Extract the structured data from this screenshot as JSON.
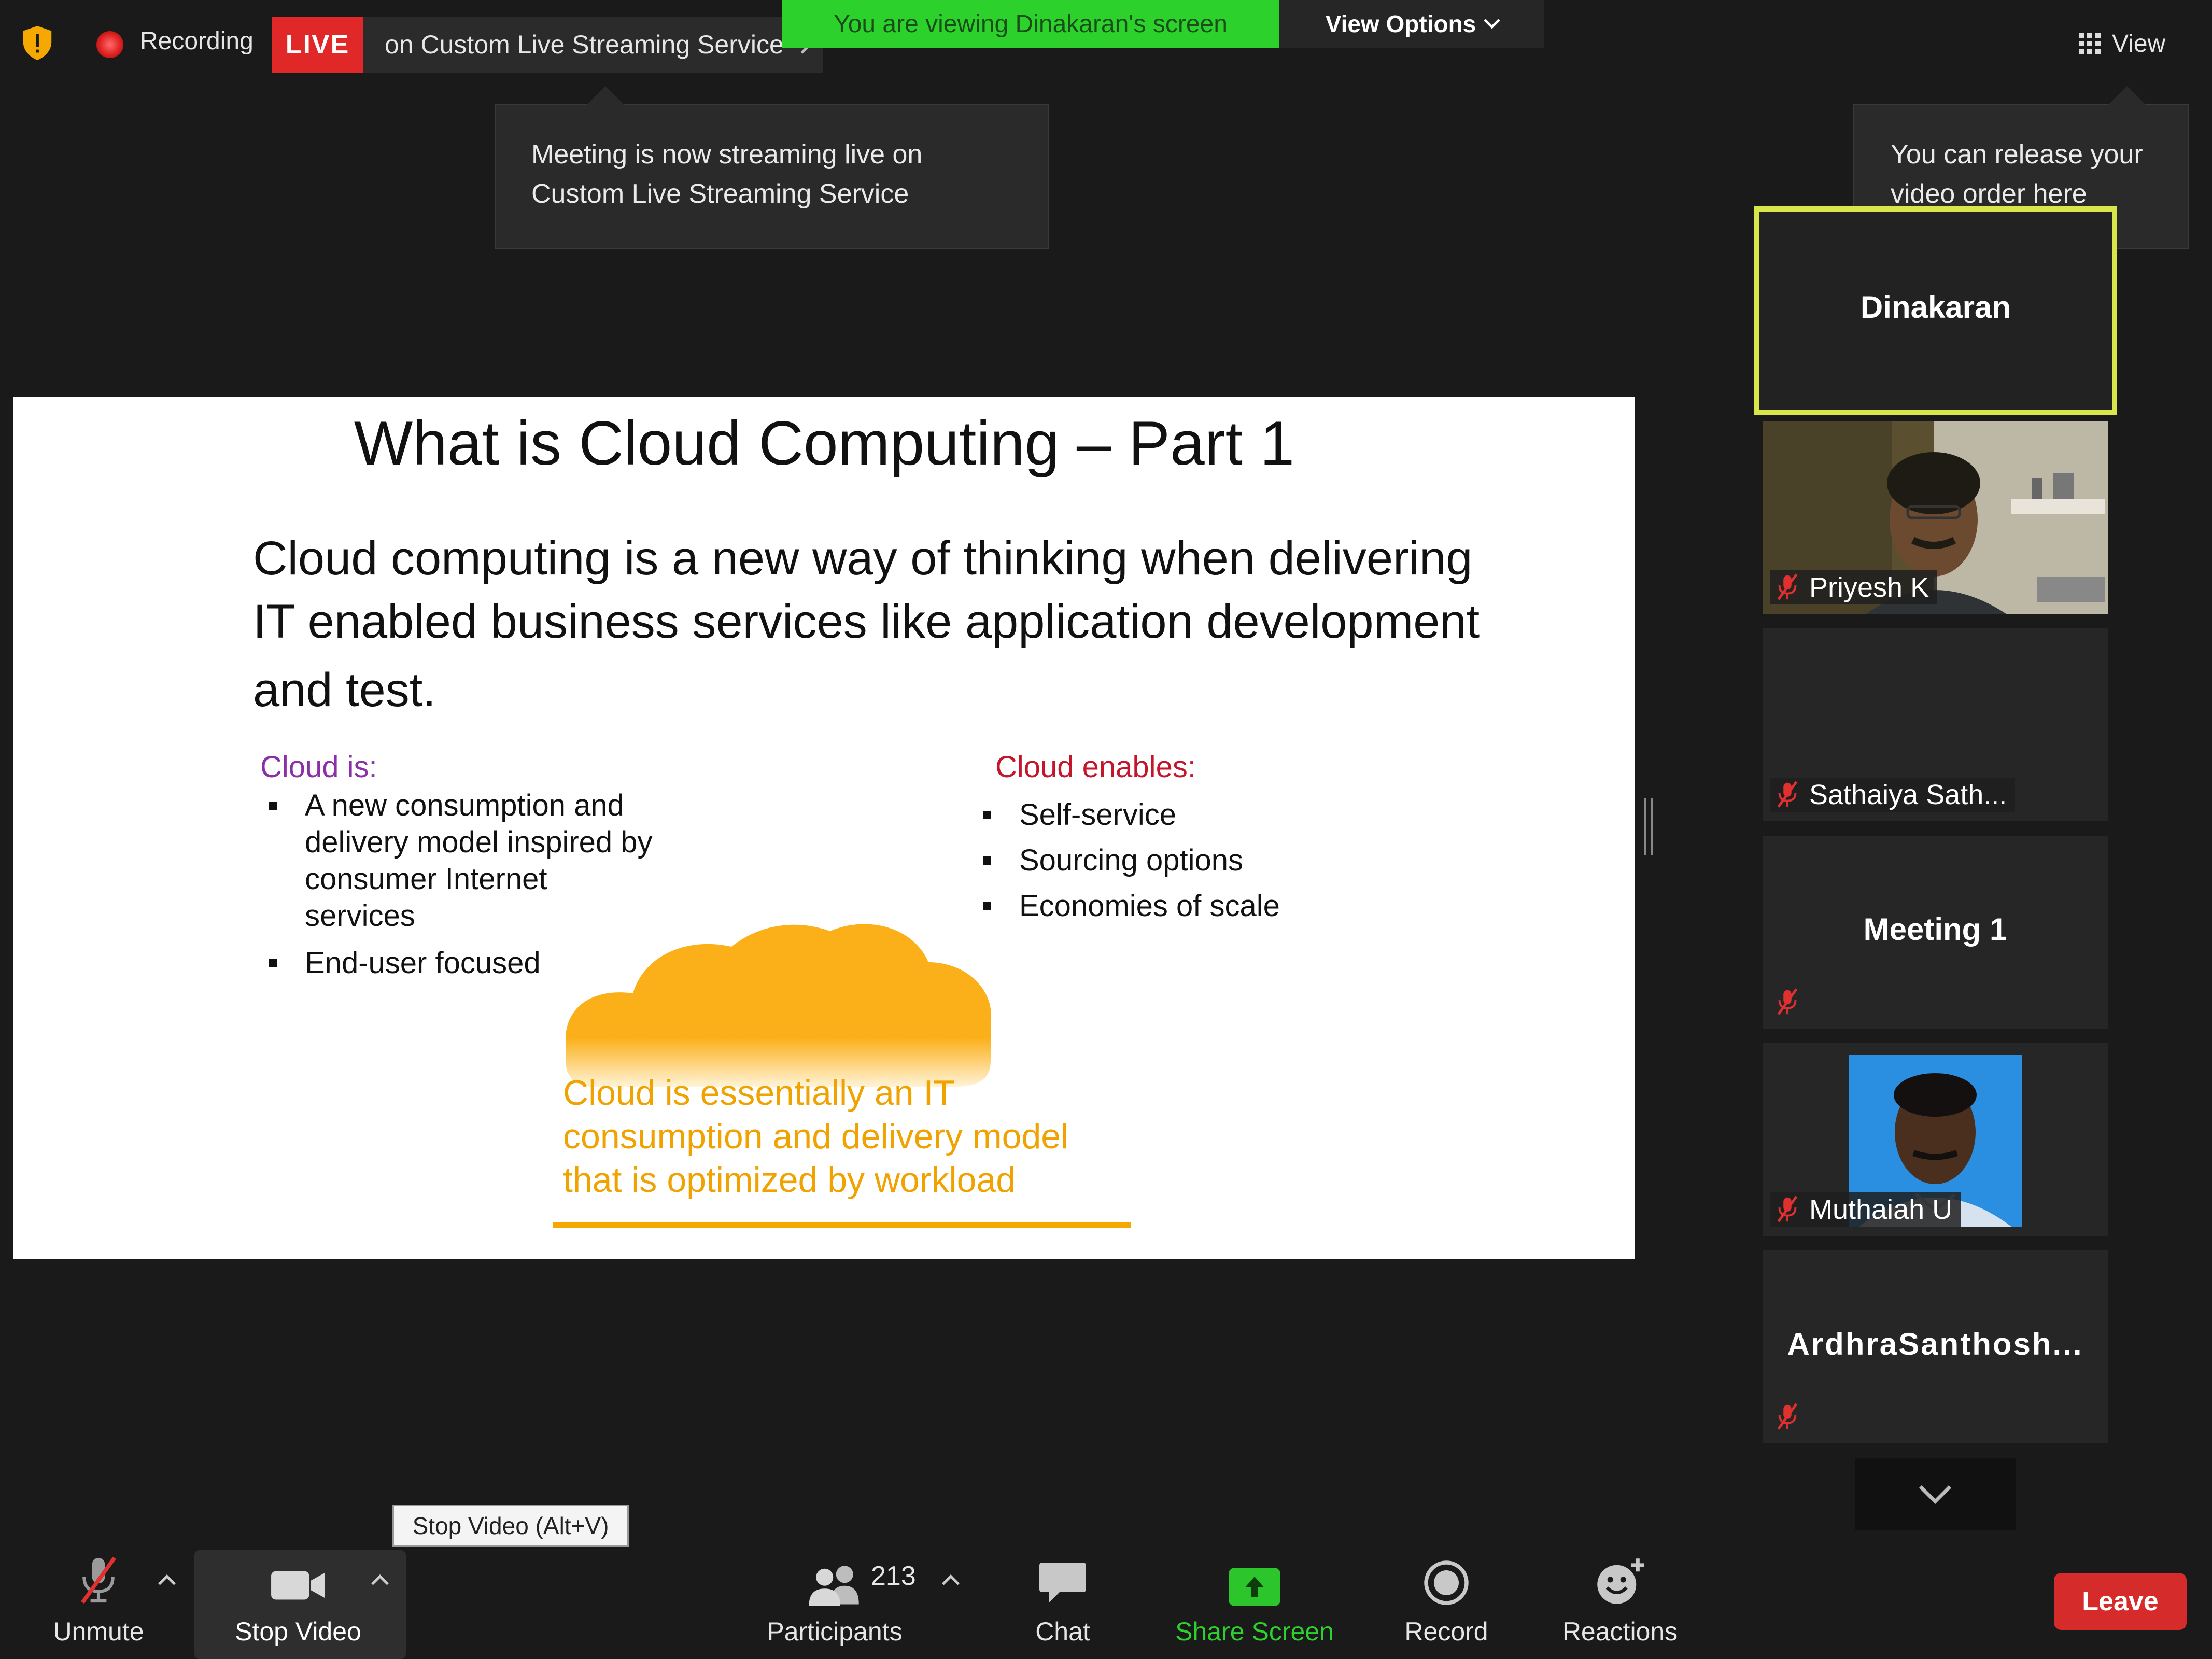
{
  "topbar": {
    "recording_label": "Recording",
    "live_badge": "LIVE",
    "live_service": "on Custom Live Streaming Service",
    "viewing_banner": "You are viewing Dinakaran's screen",
    "view_options": "View Options",
    "view_button": "View"
  },
  "tooltips": {
    "stream_line1": "Meeting is now streaming live on",
    "stream_line2": "Custom Live Streaming Service",
    "release_line1": "You can release your",
    "release_line2": "video order here"
  },
  "slide": {
    "title": "What is Cloud Computing – Part 1",
    "body_line1": "Cloud computing is a new way of thinking when delivering",
    "body_line2": "IT enabled business services like application development",
    "body_line3": "and test.",
    "cloud_is_heading": "Cloud is:",
    "cloud_is_items": [
      "A new consumption and delivery model inspired by consumer Internet services",
      "End-user focused"
    ],
    "cloud_enables_heading": "Cloud enables:",
    "cloud_enables_items": [
      "Self-service",
      "Sourcing options",
      "Economies of scale"
    ],
    "cloud_text_line1": "Cloud is essentially an IT",
    "cloud_text_line2": "consumption and delivery model",
    "cloud_text_line3": "that is optimized by workload",
    "cloud_color": "#fbb01a",
    "accent_color": "#f5a800"
  },
  "participants": [
    {
      "name": "Dinakaran",
      "active": true
    },
    {
      "name": "Priyesh K",
      "muted": true
    },
    {
      "name": "Sathaiya Sath...",
      "muted": true
    },
    {
      "name": "Meeting 1",
      "muted": true
    },
    {
      "name": "Muthaiah U",
      "muted": true
    },
    {
      "name": "ArdhraSanthosh...",
      "muted": true
    }
  ],
  "toolbar": {
    "unmute": "Unmute",
    "stop_video": "Stop Video",
    "stop_video_tooltip": "Stop Video (Alt+V)",
    "participants": "Participants",
    "participant_count": "213",
    "chat": "Chat",
    "share_screen": "Share Screen",
    "record": "Record",
    "reactions": "Reactions",
    "leave": "Leave"
  },
  "colors": {
    "live_red": "#e02828",
    "viewing_green": "#2cd12c",
    "active_speaker_border": "#d8e64a",
    "share_green": "#2cc62c",
    "leave_red": "#d62b2b"
  }
}
